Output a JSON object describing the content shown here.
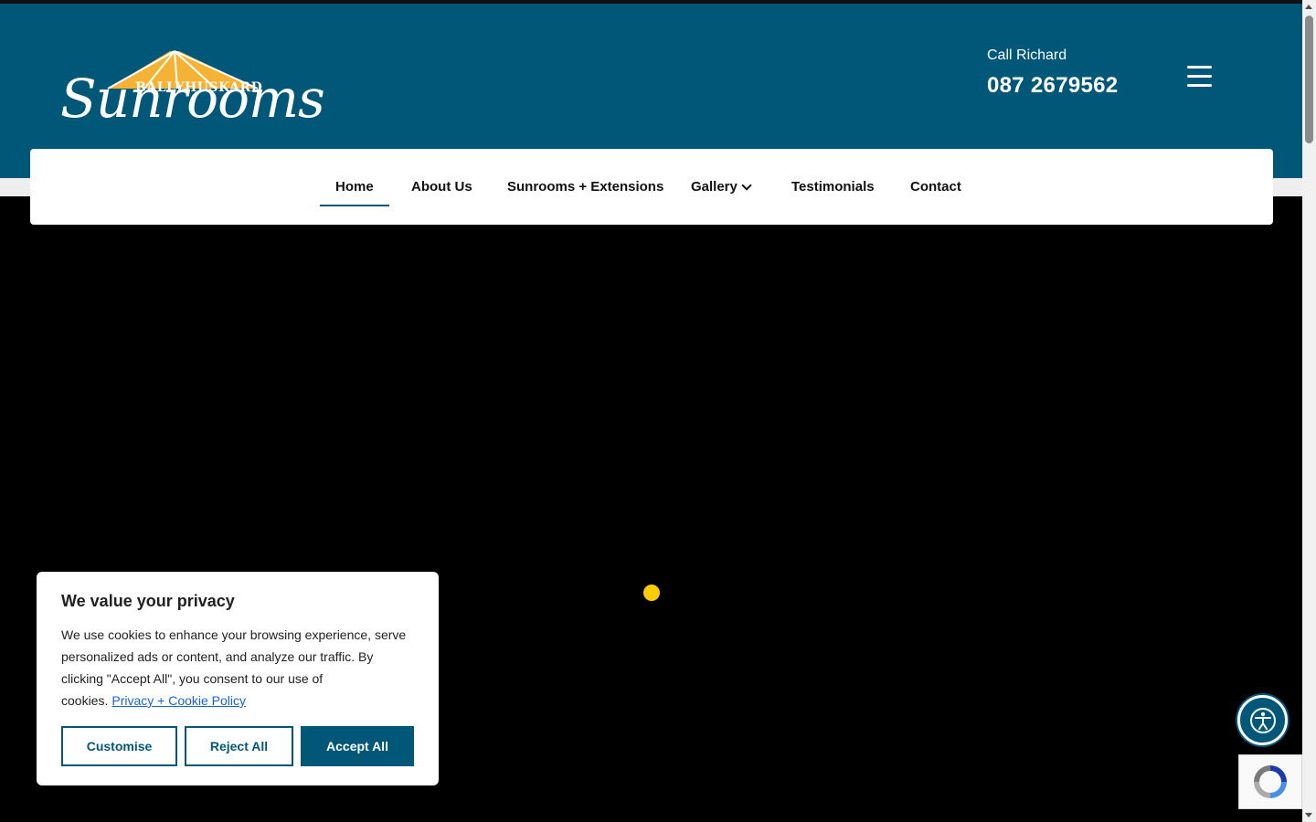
{
  "brand": {
    "name_top": "BALLYHUSKARD",
    "name_main": "Sunrooms",
    "colors": {
      "primary": "#005777",
      "roof": "#f5b335",
      "accent_dot": "#ffcc00"
    }
  },
  "header": {
    "call_label": "Call Richard",
    "call_number": "087 2679562",
    "menu_icon": "hamburger-icon"
  },
  "nav": {
    "items": [
      {
        "label": "Home",
        "active": true
      },
      {
        "label": "About Us"
      },
      {
        "label": "Sunrooms + Extensions"
      },
      {
        "label": "Gallery",
        "has_dropdown": true
      },
      {
        "label": "Testimonials"
      },
      {
        "label": "Contact"
      }
    ]
  },
  "cookie": {
    "title": "We value your privacy",
    "text": "We use cookies to enhance your browsing experience, serve personalized ads or content, and analyze our traffic. By clicking \"Accept All\", you consent to our use of cookies.",
    "link": "Privacy + Cookie Policy",
    "customise": "Customise",
    "reject": "Reject All",
    "accept": "Accept All"
  },
  "widgets": {
    "accessibility_icon": "accessibility-icon",
    "recaptcha_icon": "recaptcha-icon"
  }
}
